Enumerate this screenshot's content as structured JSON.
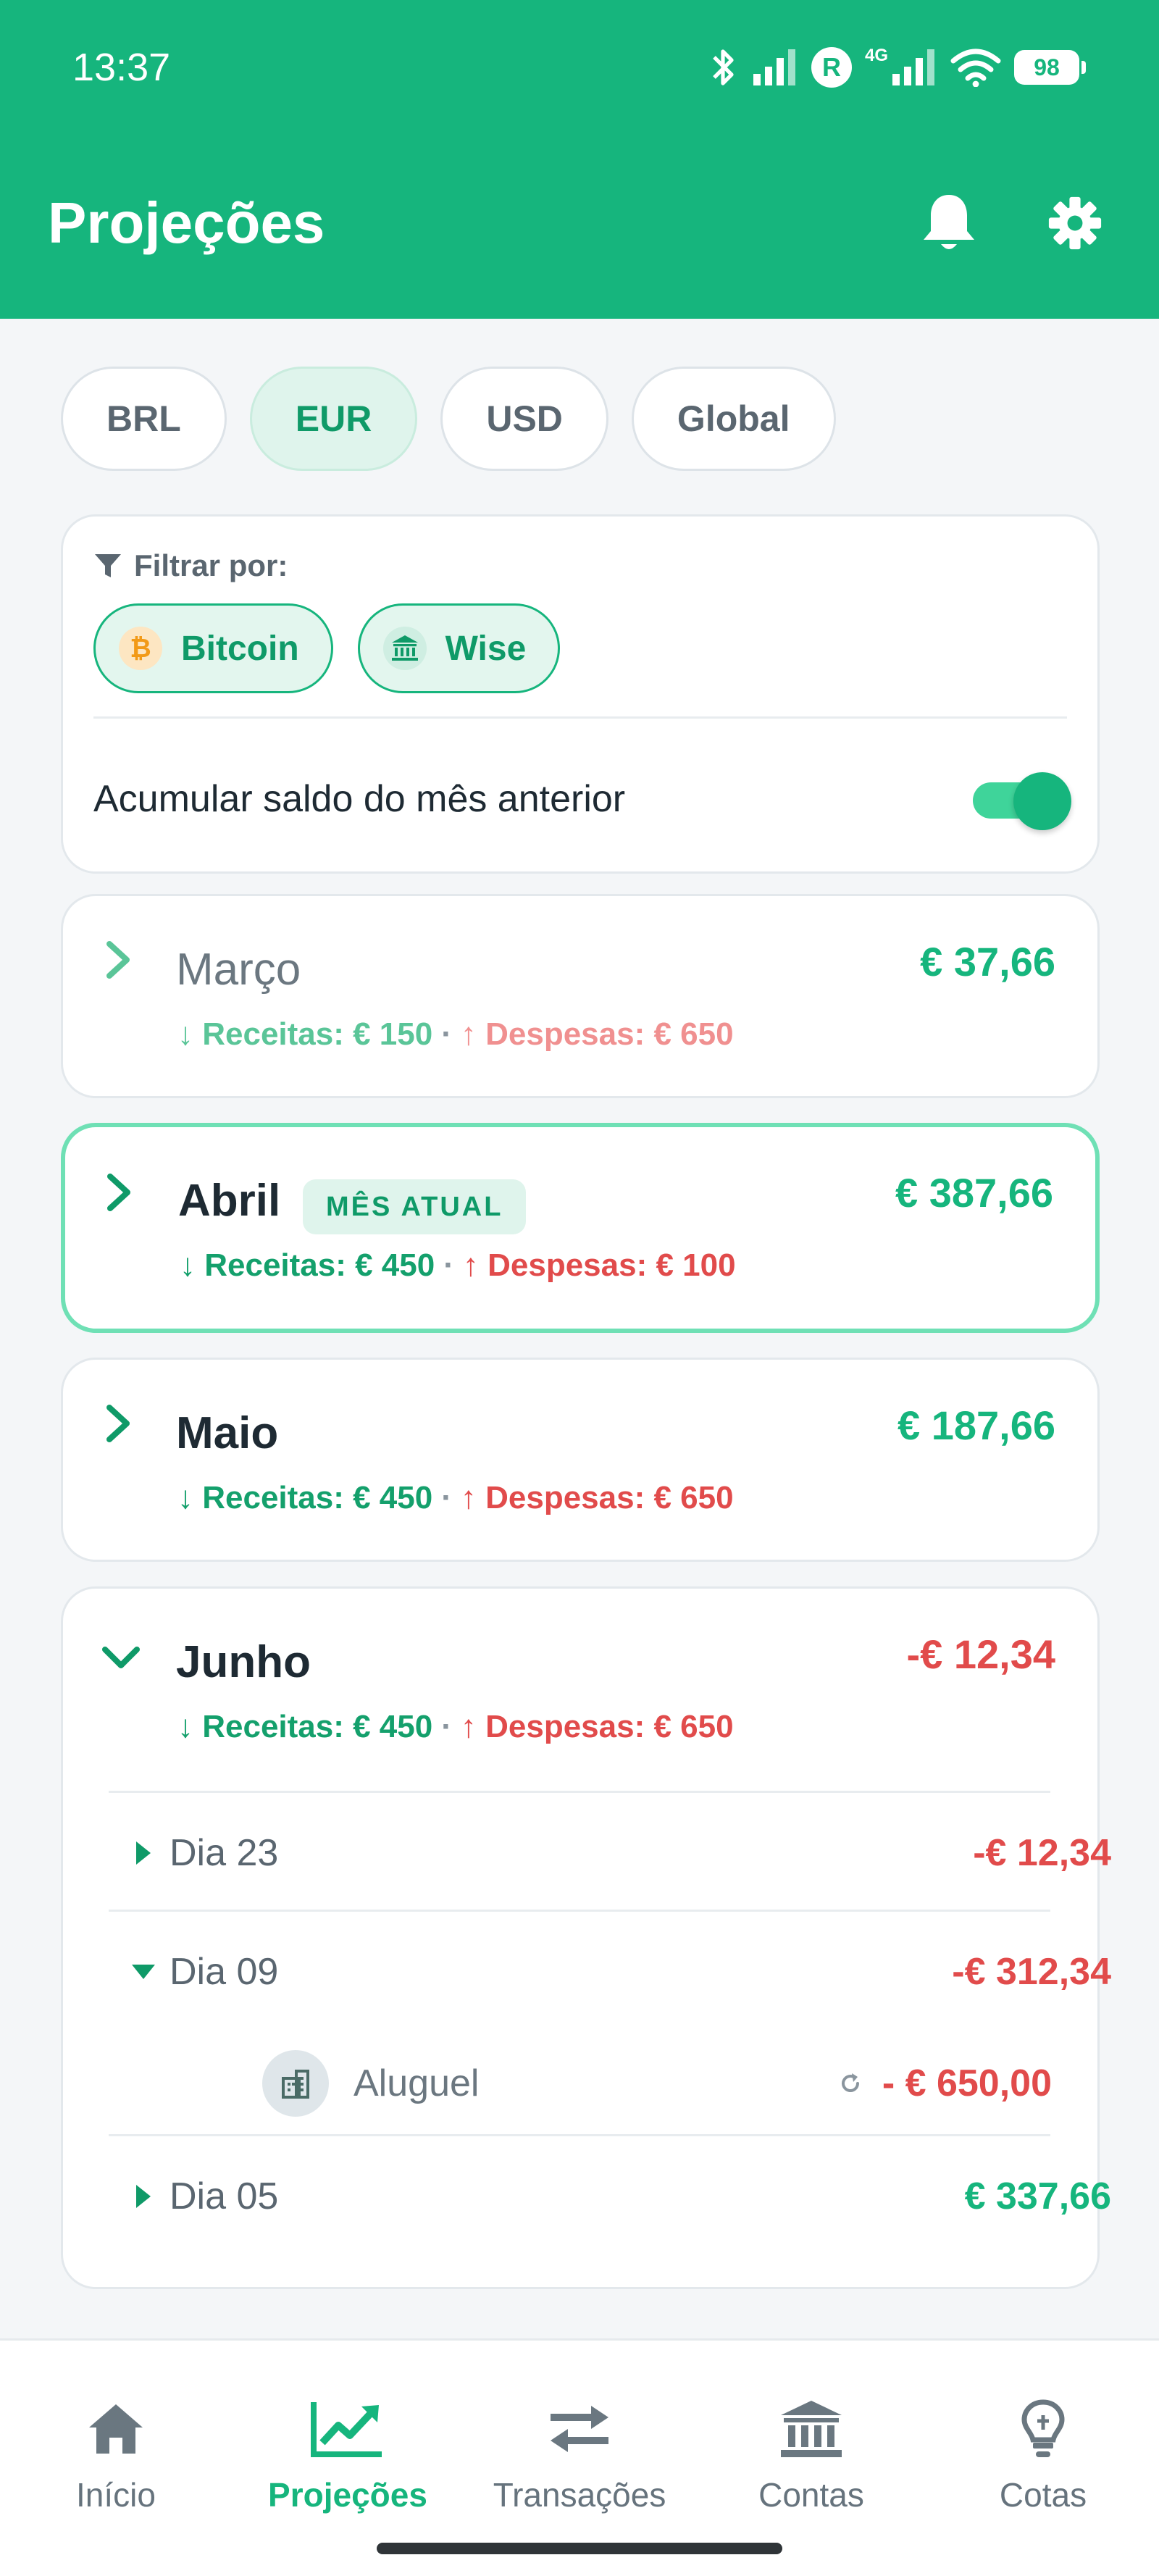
{
  "status_bar": {
    "time": "13:37",
    "battery": "98",
    "network": "4G",
    "r_badge": "R"
  },
  "header": {
    "title": "Projeções"
  },
  "currency_tabs": [
    {
      "label": "BRL",
      "active": false
    },
    {
      "label": "EUR",
      "active": true
    },
    {
      "label": "USD",
      "active": false
    },
    {
      "label": "Global",
      "active": false
    }
  ],
  "filter": {
    "label": "Filtrar por:",
    "chips": [
      {
        "label": "Bitcoin",
        "icon": "bitcoin-icon",
        "symbol": "₿"
      },
      {
        "label": "Wise",
        "icon": "bank-icon"
      }
    ],
    "accumulate_label": "Acumular saldo do mês anterior",
    "accumulate_on": true
  },
  "months": {
    "marco": {
      "name": "Março",
      "total": "€ 37,66",
      "income": "↓ Receitas: € 150",
      "separator": "·",
      "expense": "↑ Despesas: € 650"
    },
    "abril": {
      "name": "Abril",
      "badge": "MÊS ATUAL",
      "total": "€ 387,66",
      "income": "↓ Receitas: € 450",
      "separator": "·",
      "expense": "↑ Despesas: € 100"
    },
    "maio": {
      "name": "Maio",
      "total": "€ 187,66",
      "income": "↓ Receitas: € 450",
      "separator": "·",
      "expense": "↑ Despesas: € 650"
    },
    "junho": {
      "name": "Junho",
      "total": "-€ 12,34",
      "income": "↓ Receitas: € 450",
      "separator": "·",
      "expense": "↑ Despesas: € 650",
      "days": {
        "d23": {
          "label": "Dia 23",
          "value": "-€ 12,34"
        },
        "d09": {
          "label": "Dia 09",
          "value": "-€ 312,34"
        },
        "d05": {
          "label": "Dia 05",
          "value": "€ 337,66"
        }
      },
      "transaction": {
        "name": "Aluguel",
        "value": "- € 650,00",
        "recurring": true
      }
    }
  },
  "bottom_nav": [
    {
      "label": "Início",
      "icon": "home-icon"
    },
    {
      "label": "Projeções",
      "icon": "chart-line-icon",
      "active": true
    },
    {
      "label": "Transações",
      "icon": "transfer-icon"
    },
    {
      "label": "Contas",
      "icon": "bank-icon"
    },
    {
      "label": "Cotas",
      "icon": "lightbulb-icon"
    }
  ],
  "colors": {
    "primary": "#16b57d",
    "income": "#14a06c",
    "expense": "#e14b4b",
    "accent_border": "#6fe0b5"
  }
}
